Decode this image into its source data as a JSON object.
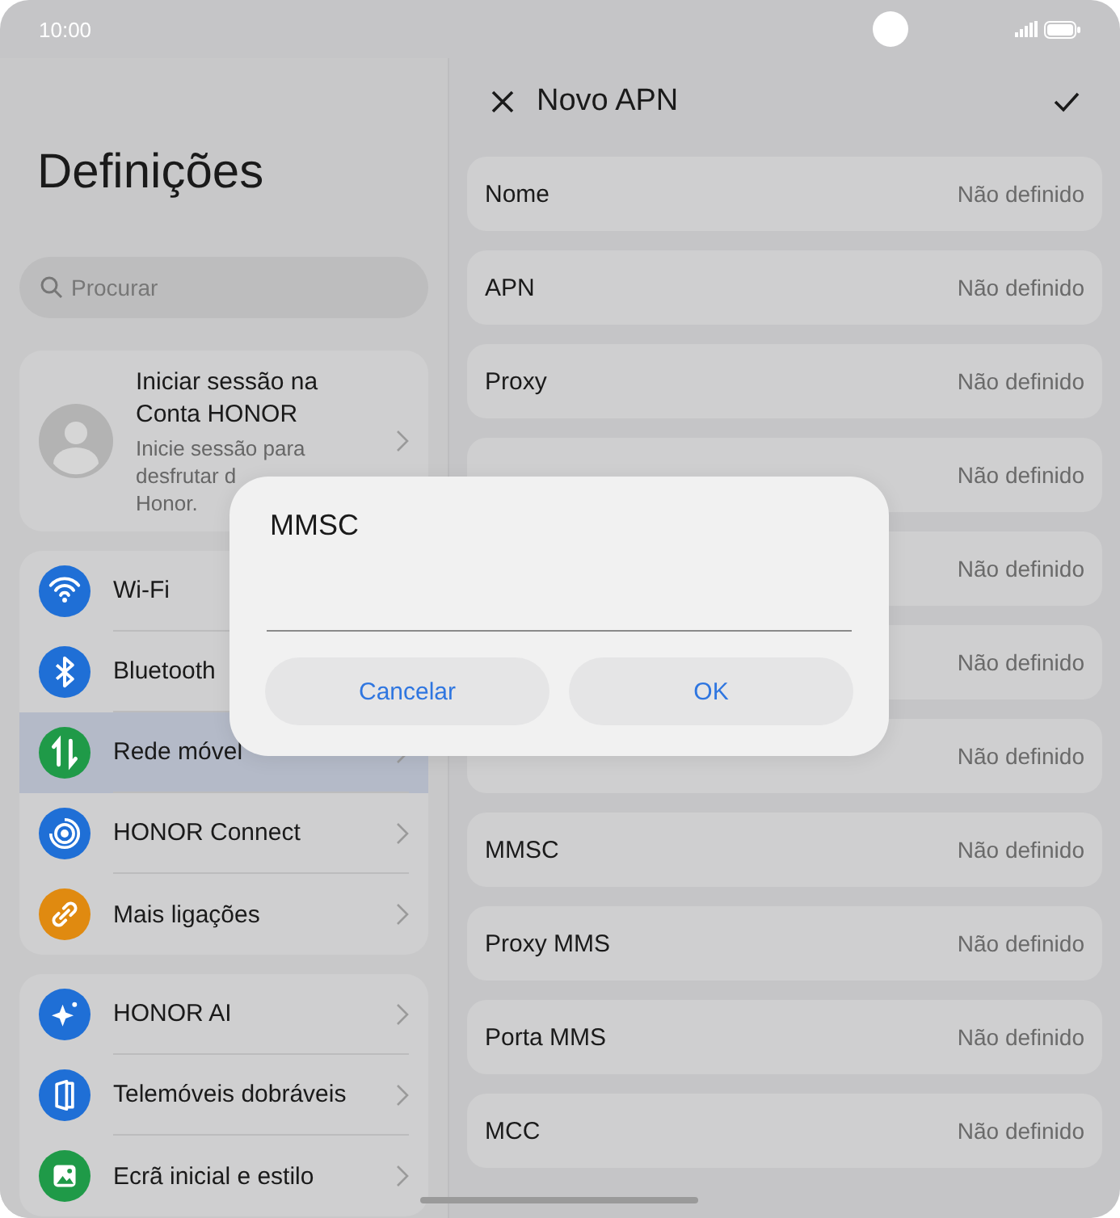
{
  "status_bar": {
    "time": "10:00"
  },
  "sidebar": {
    "title": "Definições",
    "search": {
      "placeholder": "Procurar"
    },
    "account": {
      "title": "Iniciar sessão na Conta HONOR",
      "subtitle_lines": [
        "Inicie sessão para",
        "desfrutar d",
        "Honor."
      ]
    },
    "groups": [
      {
        "items": [
          {
            "label": "Wi-Fi",
            "kind": "wifi",
            "color": "#1f6fd6",
            "selected": false
          },
          {
            "label": "Bluetooth",
            "kind": "bluetooth",
            "color": "#1f6fd6",
            "selected": false
          },
          {
            "label": "Rede móvel",
            "kind": "updown",
            "color": "#1f9a48",
            "selected": true,
            "chevron": true
          },
          {
            "label": "HONOR Connect",
            "kind": "connect",
            "color": "#1f6fd6",
            "selected": false,
            "chevron": true
          },
          {
            "label": "Mais ligações",
            "kind": "link",
            "color": "#e08a10",
            "selected": false,
            "chevron": true
          }
        ]
      },
      {
        "items": [
          {
            "label": "HONOR AI",
            "kind": "sparkle",
            "color": "#1f6fd6",
            "selected": false,
            "chevron": true
          },
          {
            "label": "Telemóveis dobráveis",
            "kind": "fold",
            "color": "#1f6fd6",
            "selected": false,
            "chevron": true
          },
          {
            "label": "Ecrã inicial e estilo",
            "kind": "image",
            "color": "#1f9a48",
            "selected": false,
            "chevron": true
          }
        ]
      }
    ]
  },
  "header": {
    "title": "Novo APN"
  },
  "fields": [
    {
      "label": "Nome",
      "value": "Não definido"
    },
    {
      "label": "APN",
      "value": "Não definido"
    },
    {
      "label": "Proxy",
      "value": "Não definido"
    },
    {
      "value": "Não definido"
    },
    {
      "value": "Não definido"
    },
    {
      "value": "Não definido"
    },
    {
      "value": "Não definido"
    },
    {
      "label": "MMSC",
      "value": "Não definido"
    },
    {
      "label": "Proxy MMS",
      "value": "Não definido"
    },
    {
      "label": "Porta MMS",
      "value": "Não definido"
    },
    {
      "label": "MCC",
      "value": "Não definido"
    }
  ],
  "dialog": {
    "title": "MMSC",
    "buttons": [
      "Cancelar",
      "OK"
    ]
  }
}
